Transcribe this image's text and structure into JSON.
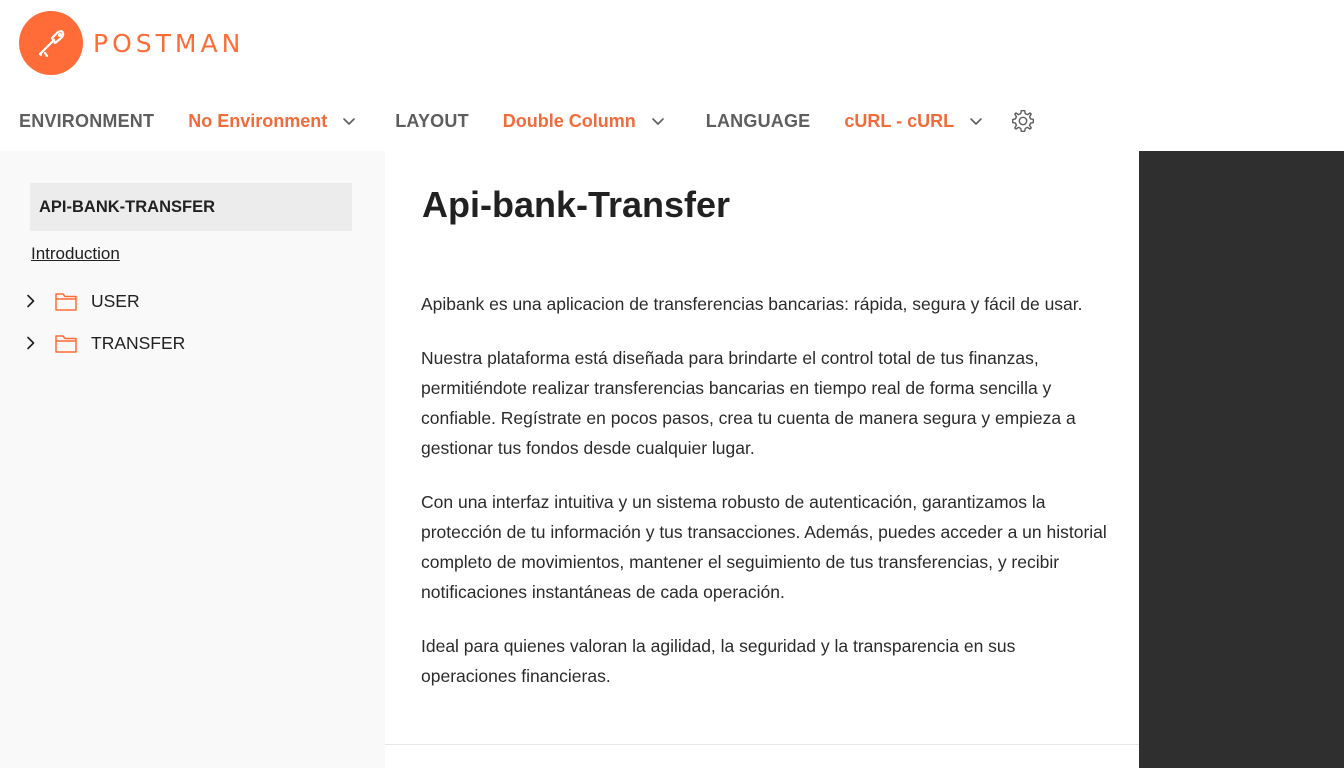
{
  "brand": {
    "name": "POSTMAN",
    "accent_color": "#ff6c37",
    "logo_icon": "postman-logo-icon"
  },
  "toolbar": {
    "environment_label": "ENVIRONMENT",
    "environment_value": "No Environment",
    "layout_label": "LAYOUT",
    "layout_value": "Double Column",
    "language_label": "LANGUAGE",
    "language_value": "cURL - cURL",
    "settings_icon": "gear-icon"
  },
  "sidebar": {
    "collection_name": "API-BANK-TRANSFER",
    "intro_link": "Introduction",
    "folders": [
      {
        "name": "USER",
        "icon": "folder-icon"
      },
      {
        "name": "TRANSFER",
        "icon": "folder-icon"
      }
    ]
  },
  "main": {
    "title": "Api-bank-Transfer",
    "paragraphs": [
      "Apibank es una aplicacion de transferencias bancarias: rápida, segura y fácil de usar.",
      "Nuestra plataforma está diseñada para brindarte el control total de tus finanzas, permitiéndote realizar transferencias bancarias en tiempo real de forma sencilla y confiable. Regístrate en pocos pasos, crea tu cuenta de manera segura y empieza a gestionar tus fondos desde cualquier lugar.",
      "Con una interfaz intuitiva y un sistema robusto de autenticación, garantizamos la protección de tu información y tus transacciones. Además, puedes acceder a un historial completo de movimientos, mantener el seguimiento de tus transferencias, y recibir notificaciones instantáneas de cada operación.",
      "Ideal para quienes valoran la agilidad, la seguridad y la transparencia en sus operaciones financieras."
    ]
  },
  "colors": {
    "value_orange": "#f26b3a",
    "sidebar_bg": "#f9f9f9",
    "right_panel_bg": "#2f2f2f"
  }
}
